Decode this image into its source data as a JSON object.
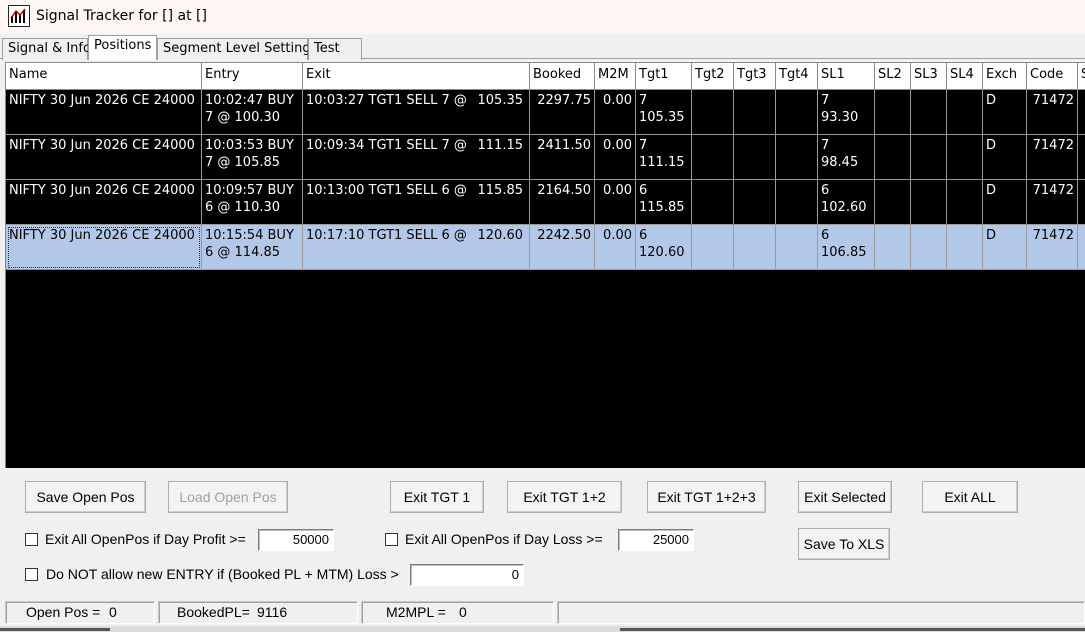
{
  "window": {
    "title": "Signal Tracker for [] at []"
  },
  "tabs": [
    {
      "label": "Signal & Info",
      "active": false
    },
    {
      "label": "Positions",
      "active": true
    },
    {
      "label": "Segment Level Settings",
      "active": false
    },
    {
      "label": "Test",
      "active": false
    }
  ],
  "grid": {
    "columns": [
      "Name",
      "Entry",
      "Exit",
      "Booked",
      "M2M",
      "Tgt1",
      "Tgt2",
      "Tgt3",
      "Tgt4",
      "SL1",
      "SL2",
      "SL3",
      "SL4",
      "Exch",
      "Code",
      "S"
    ],
    "rows": [
      {
        "name": "NIFTY 30 Jun 2026 CE 24000",
        "entry": "10:02:47 BUY\n7 @ 100.30",
        "exit_text": "10:03:27 TGT1 SELL 7 @",
        "exit_price": "105.35",
        "booked": "2297.75",
        "m2m": "0.00",
        "tgt1": "7\n105.35",
        "tgt2": "",
        "tgt3": "",
        "tgt4": "",
        "sl1": "7\n93.30",
        "sl2": "",
        "sl3": "",
        "sl4": "",
        "exch": "D",
        "code": "71472",
        "selected": false
      },
      {
        "name": "NIFTY 30 Jun 2026 CE 24000",
        "entry": "10:03:53 BUY\n7 @ 105.85",
        "exit_text": "10:09:34 TGT1 SELL 7 @",
        "exit_price": "111.15",
        "booked": "2411.50",
        "m2m": "0.00",
        "tgt1": "7\n111.15",
        "tgt2": "",
        "tgt3": "",
        "tgt4": "",
        "sl1": "7\n98.45",
        "sl2": "",
        "sl3": "",
        "sl4": "",
        "exch": "D",
        "code": "71472",
        "selected": false
      },
      {
        "name": "NIFTY 30 Jun 2026 CE 24000",
        "entry": "10:09:57 BUY\n6 @ 110.30",
        "exit_text": "10:13:00 TGT1 SELL 6 @",
        "exit_price": "115.85",
        "booked": "2164.50",
        "m2m": "0.00",
        "tgt1": "6\n115.85",
        "tgt2": "",
        "tgt3": "",
        "tgt4": "",
        "sl1": "6\n102.60",
        "sl2": "",
        "sl3": "",
        "sl4": "",
        "exch": "D",
        "code": "71472",
        "selected": false
      },
      {
        "name": "NIFTY 30 Jun 2026 CE 24000",
        "entry": "10:15:54 BUY\n6 @ 114.85",
        "exit_text": "10:17:10 TGT1 SELL 6 @",
        "exit_price": "120.60",
        "booked": "2242.50",
        "m2m": "0.00",
        "tgt1": "6\n120.60",
        "tgt2": "",
        "tgt3": "",
        "tgt4": "",
        "sl1": "6\n106.85",
        "sl2": "",
        "sl3": "",
        "sl4": "",
        "exch": "D",
        "code": "71472",
        "selected": true
      }
    ]
  },
  "buttons": {
    "save_open_pos": "Save Open Pos",
    "load_open_pos": "Load Open Pos",
    "exit_tgt1": "Exit TGT 1",
    "exit_tgt12": "Exit TGT 1+2",
    "exit_tgt123": "Exit TGT 1+2+3",
    "exit_selected": "Exit Selected",
    "exit_all": "Exit ALL",
    "save_xls": "Save To XLS"
  },
  "options": {
    "profit_label": "Exit All OpenPos if Day Profit >=",
    "profit_value": "50000",
    "loss_label": "Exit All OpenPos if Day Loss >=",
    "loss_value": "25000",
    "no_entry_label": "Do NOT allow new ENTRY if (Booked PL + MTM) Loss >",
    "no_entry_value": "0"
  },
  "status": {
    "open_pos_label": "Open Pos =",
    "open_pos_value": "0",
    "booked_label": "BookedPL=",
    "booked_value": "9116",
    "m2m_label": "M2MPL =",
    "m2m_value": "0"
  },
  "colors": {
    "grid_bg": "#000000",
    "selected_row": "#b3c8e8"
  }
}
